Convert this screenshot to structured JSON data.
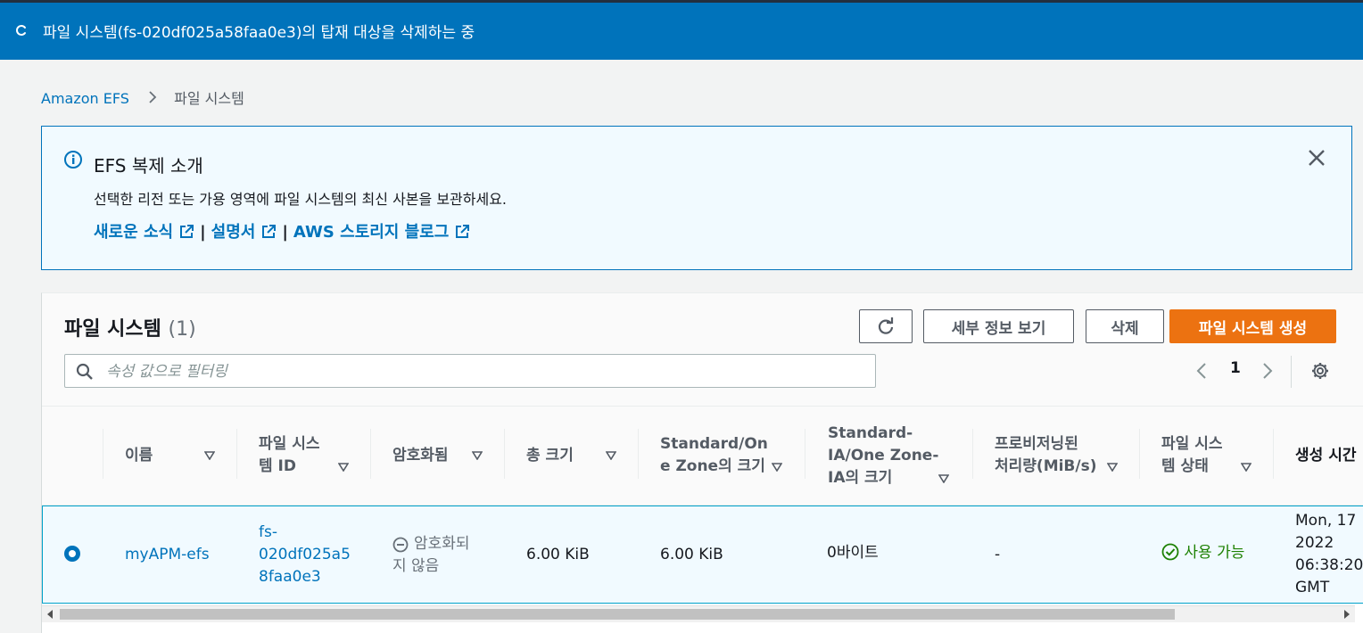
{
  "flash": {
    "message": "파일 시스템(fs-020df025a58faa0e3)의 탑재 대상을 삭제하는 중",
    "color": "#0073bb"
  },
  "breadcrumb": {
    "root": "Amazon EFS",
    "current": "파일 시스템"
  },
  "alert": {
    "title": "EFS 복제 소개",
    "description": "선택한 리전 또는 가용 영역에 파일 시스템의 최신 사본을 보관하세요.",
    "links": [
      "새로운 소식",
      "설명서",
      "AWS 스토리지 블로그"
    ],
    "separator": "|"
  },
  "table": {
    "title": "파일 시스템",
    "count": "(1)",
    "buttons": {
      "details": "세부 정보 보기",
      "delete": "삭제",
      "create": "파일 시스템 생성"
    },
    "search_placeholder": "속성 값으로 필터링",
    "page": "1",
    "columns": [
      "이름",
      "파일 시스\n템 ID",
      "암호화됨",
      "총 크기",
      "Standard/On\ne Zone의 크기",
      "Standard-\nIA/One Zone-\nIA의 크기",
      "프로비저닝된\n처리량(MiB/s)",
      "파일 시스\n템 상태",
      "생성 시간"
    ],
    "rows": [
      {
        "name": "myAPM-efs",
        "id": "fs-\n020df025a5\n8faa0e3",
        "encrypted": "암호화되\n지 않음",
        "total_size": "6.00 KiB",
        "standard_size": "6.00 KiB",
        "ia_size": "0바이트",
        "throughput": "-",
        "state": "사용 가능",
        "created": "Mon, 17\n2022\n06:38:20\nGMT"
      }
    ]
  },
  "colors": {
    "primary_button": "#ec7211",
    "link": "#0073bb",
    "success": "#1d8102"
  }
}
